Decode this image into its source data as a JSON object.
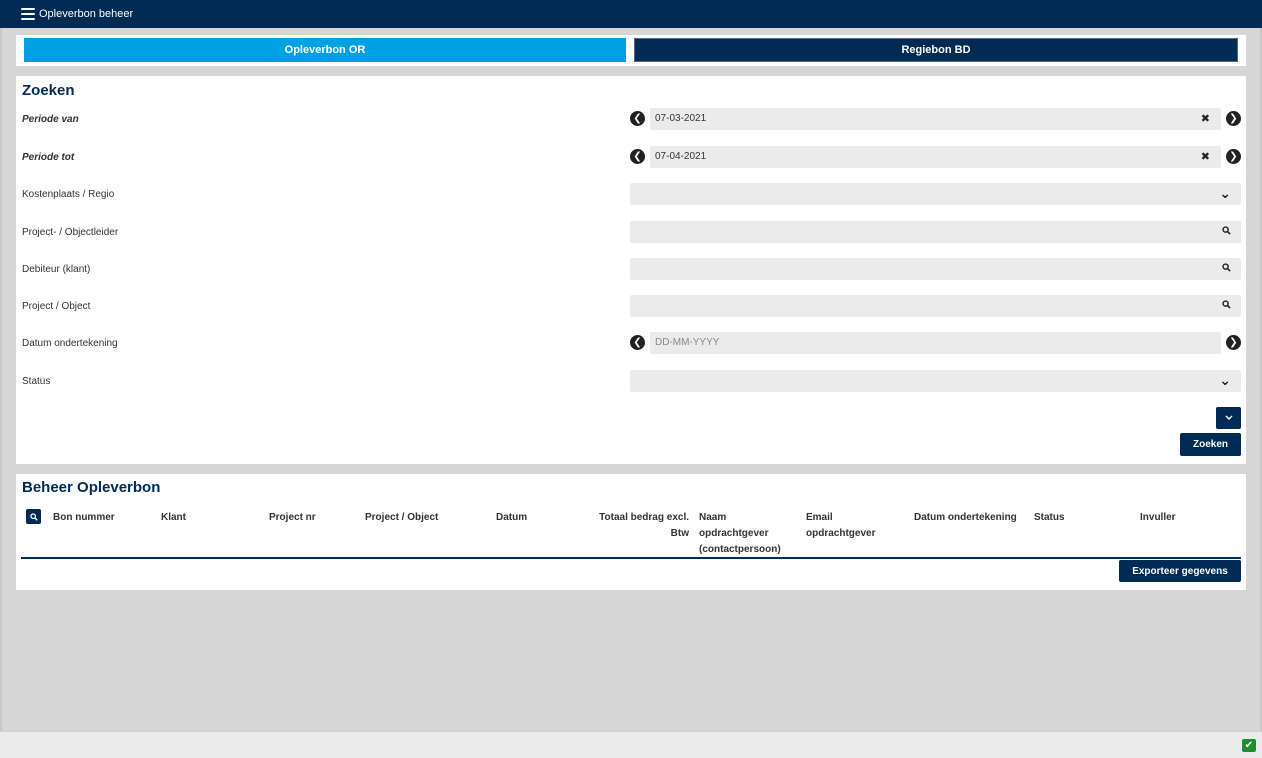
{
  "header": {
    "menu_icon": "hamburger-menu-icon",
    "title": "Opleverbon beheer"
  },
  "tabs": [
    {
      "label": "Opleverbon OR",
      "active": true
    },
    {
      "label": "Regiebon BD",
      "active": false
    }
  ],
  "search": {
    "title": "Zoeken",
    "fields": {
      "periode_van": {
        "label": "Periode van",
        "value": "07-03-2021"
      },
      "periode_tot": {
        "label": "Periode tot",
        "value": "07-04-2021"
      },
      "kostenplaats": {
        "label": "Kostenplaats / Regio",
        "value": ""
      },
      "projectleider": {
        "label": "Project- / Objectleider",
        "value": ""
      },
      "debiteur": {
        "label": "Debiteur (klant)",
        "value": ""
      },
      "project": {
        "label": "Project / Object",
        "value": ""
      },
      "datum_ondertekening": {
        "label": "Datum ondertekening",
        "placeholder": "DD-MM-YYYY"
      },
      "status": {
        "label": "Status",
        "value": ""
      }
    },
    "clear_glyph": "✖",
    "prev_glyph": "❮",
    "next_glyph": "❯",
    "dropdown_glyph": "⌄",
    "search_button": "Zoeken"
  },
  "results": {
    "title": "Beheer Opleverbon",
    "columns": {
      "bon_nummer": "Bon nummer",
      "klant": "Klant",
      "project_nr": "Project nr",
      "project_object": "Project / Object",
      "datum": "Datum",
      "totaal_line1": "Totaal bedrag excl.",
      "totaal_line2": "Btw",
      "naam_line1": "Naam",
      "naam_line2": "opdrachtgever",
      "naam_line3": "(contactpersoon)",
      "email_line1": "Email",
      "email_line2": "opdrachtgever",
      "datum_ondertekening": "Datum ondertekening",
      "status": "Status",
      "invuller": "Invuller"
    },
    "export_button": "Exporteer gegevens"
  },
  "footer": {
    "status_icon": "check-icon"
  },
  "colors": {
    "navy": "#002b55",
    "accent": "#00a0e3",
    "success": "#1a8f2e"
  }
}
